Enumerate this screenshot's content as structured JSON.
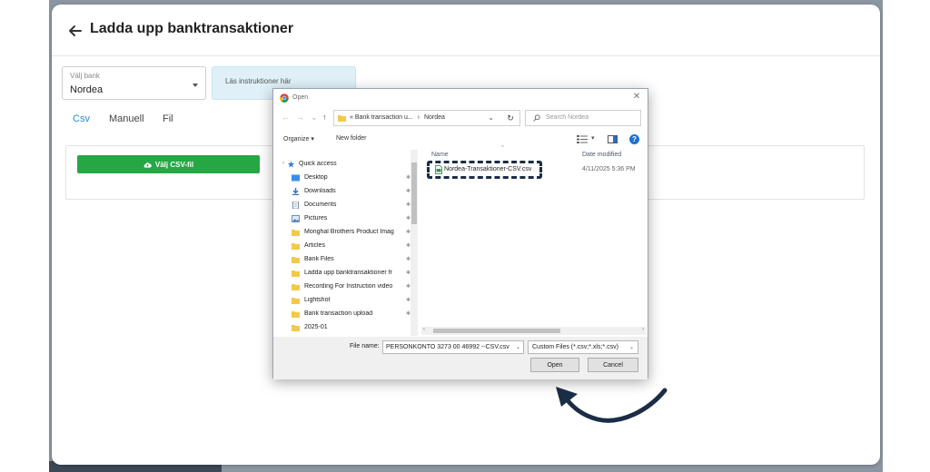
{
  "page": {
    "title": "Ladda upp banktransaktioner",
    "back_icon": "arrow-left-icon"
  },
  "bank_select": {
    "label": "Välj bank",
    "value": "Nordea"
  },
  "instructions": {
    "text": "Läs instruktioner här"
  },
  "mode_tabs": [
    {
      "label": "Csv",
      "active": true
    },
    {
      "label": "Manuell",
      "active": false
    },
    {
      "label": "Fil",
      "active": false
    }
  ],
  "upload": {
    "button_label": "Välj CSV-fil",
    "button_icon": "cloud-upload-icon",
    "button_color": "#27a744"
  },
  "dialog": {
    "title": "Open",
    "close_glyph": "✕",
    "nav": {
      "back": "←",
      "forward": "→",
      "recent": "⌄",
      "up": "↑",
      "refresh": "↻",
      "address_prefix": "«",
      "address_parent": "Bank transaction u...",
      "address_separator": "›",
      "address_current": "Nordea",
      "address_caret": "⌄"
    },
    "search_placeholder": "Search Nordea",
    "toolbar": {
      "organize": "Organize ▾",
      "new_folder": "New folder",
      "view_caret": "▾",
      "help": "?"
    },
    "nav_items": [
      {
        "label": "Quick access",
        "icon": "star-icon",
        "pinned": false
      },
      {
        "label": "Desktop",
        "icon": "desktop-icon",
        "pinned": true
      },
      {
        "label": "Downloads",
        "icon": "download-icon",
        "pinned": true
      },
      {
        "label": "Documents",
        "icon": "document-icon",
        "pinned": true
      },
      {
        "label": "Pictures",
        "icon": "pictures-icon",
        "pinned": true
      },
      {
        "label": "Monghal Brothers Product Imag",
        "icon": "folder-icon",
        "pinned": true
      },
      {
        "label": "Articles",
        "icon": "folder-icon",
        "pinned": true
      },
      {
        "label": "Bank Files",
        "icon": "folder-icon",
        "pinned": true
      },
      {
        "label": "Ladda upp banktransaktioner fr",
        "icon": "folder-icon",
        "pinned": true
      },
      {
        "label": "Recording For Instruction video",
        "icon": "folder-icon",
        "pinned": true
      },
      {
        "label": "Lightshot",
        "icon": "folder-icon",
        "pinned": true
      },
      {
        "label": "Bank transaction upload",
        "icon": "folder-icon",
        "pinned": true
      },
      {
        "label": "2025-01",
        "icon": "folder-icon",
        "pinned": false
      }
    ],
    "pin_glyph": "📌",
    "columns": {
      "name": "Name",
      "date": "Date modified"
    },
    "files": [
      {
        "name": "Nordea-Transaktioner-CSV.csv",
        "date": "4/11/2025 5:36 PM",
        "icon": "csv-file-icon",
        "highlighted": true
      }
    ],
    "filename_label": "File name:",
    "filename_value": "PERSONKONTO 3273 00 46992 --CSV.csv",
    "filetype_value": "Custom Files (*.csv;*.xls;*.csv)",
    "open_label": "Open",
    "cancel_label": "Cancel",
    "highlight_color": "#1b2d45"
  },
  "annotation": {
    "arrow_icon": "curved-arrow-icon",
    "arrow_color": "#1b2d45"
  }
}
